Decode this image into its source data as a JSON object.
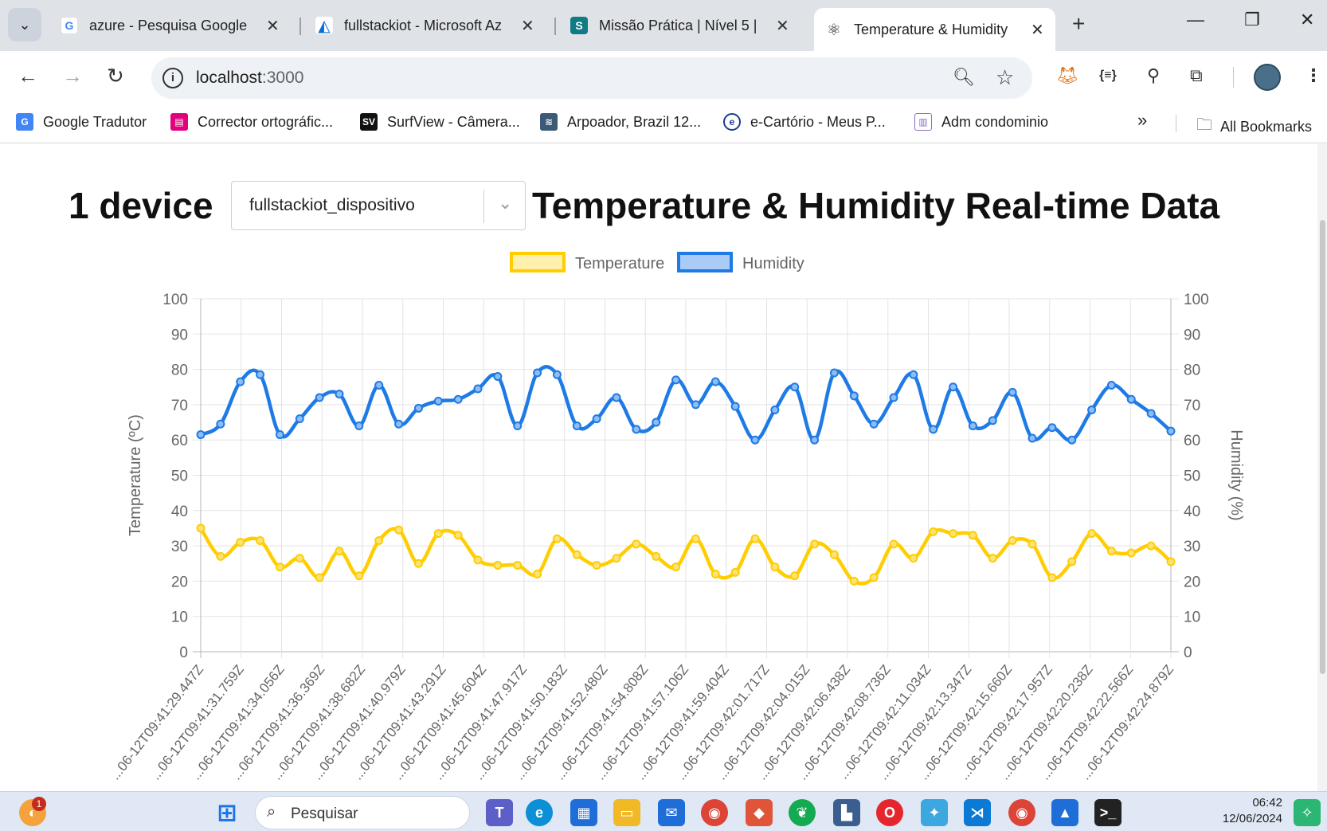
{
  "browser": {
    "tabs": [
      {
        "title": "azure - Pesquisa Google",
        "icon": "google-icon"
      },
      {
        "title": "fullstackiot - Microsoft Az",
        "icon": "azure-icon"
      },
      {
        "title": "Missão Prática | Nível 5 |",
        "icon": "sharepoint-icon"
      },
      {
        "title": "Temperature & Humidity",
        "icon": "react-icon"
      }
    ],
    "url_host": "localhost",
    "url_port": ":3000",
    "bookmarks": [
      {
        "label": "Google Tradutor"
      },
      {
        "label": "Corrector ortográfic..."
      },
      {
        "label": "SurfView - Câmera..."
      },
      {
        "label": "Arpoador, Brazil 12..."
      },
      {
        "label": "e-Cartório - Meus P..."
      },
      {
        "label": "Adm condominio"
      }
    ],
    "more_bookmarks": "»",
    "all_bookmarks": "All Bookmarks"
  },
  "page": {
    "device_count": "1 device",
    "selected_device": "fullstackiot_dispositivo",
    "title": "Temperature & Humidity Real-time Data"
  },
  "chart_data": {
    "type": "line",
    "legend": [
      "Temperature",
      "Humidity"
    ],
    "legend_position": "top",
    "y_left_label": "Temperature (ºC)",
    "y_right_label": "Humidity (%)",
    "ylim": [
      0,
      100
    ],
    "y_ticks": [
      0,
      10,
      20,
      30,
      40,
      50,
      60,
      70,
      80,
      90,
      100
    ],
    "grid": true,
    "x_tick_labels": [
      "...06-12T09:41:29.447Z",
      "...06-12T09:41:31.759Z",
      "...06-12T09:41:34.056Z",
      "...06-12T09:41:36.369Z",
      "...06-12T09:41:38.682Z",
      "...06-12T09:41:40.979Z",
      "...06-12T09:41:43.291Z",
      "...06-12T09:41:45.604Z",
      "...06-12T09:41:47.917Z",
      "...06-12T09:41:50.183Z",
      "...06-12T09:41:52.480Z",
      "...06-12T09:41:54.808Z",
      "...06-12T09:41:57.106Z",
      "...06-12T09:41:59.404Z",
      "...06-12T09:42:01.717Z",
      "...06-12T09:42:04.015Z",
      "...06-12T09:42:06.438Z",
      "...06-12T09:42:08.736Z",
      "...06-12T09:42:11.034Z",
      "...06-12T09:42:13.347Z",
      "...06-12T09:42:15.660Z",
      "...06-12T09:42:17.957Z",
      "...06-12T09:42:20.238Z",
      "...06-12T09:42:22.566Z",
      "...06-12T09:42:24.879Z"
    ],
    "series": [
      {
        "name": "Temperature",
        "color": "#ffcd00",
        "values": [
          35,
          27,
          31,
          31.5,
          24,
          26.5,
          21,
          28.5,
          21.5,
          31.5,
          34.5,
          25,
          33.5,
          33,
          26,
          24.5,
          24.5,
          22,
          32,
          27.5,
          24.5,
          26.5,
          30.5,
          27,
          24,
          32,
          22,
          22.5,
          32,
          24,
          21.5,
          30.5,
          27.5,
          20,
          21,
          30.5,
          26.5,
          34,
          33.5,
          33,
          26.5,
          31.5,
          30.5,
          21,
          25.5,
          33.5,
          28.5,
          28,
          30,
          25.5
        ]
      },
      {
        "name": "Humidity",
        "color": "#1e7be6",
        "values": [
          61.5,
          64.5,
          76.5,
          78.5,
          61.5,
          66,
          72,
          73,
          64,
          75.5,
          64.5,
          69,
          71,
          71.5,
          74.5,
          78,
          64,
          79,
          78.5,
          64,
          66,
          72,
          63,
          65,
          77,
          70,
          76.5,
          69.5,
          60,
          68.5,
          75,
          60,
          79,
          72.5,
          64.5,
          72,
          78.5,
          63,
          75,
          64,
          65.5,
          73.5,
          60.5,
          63.5,
          60,
          68.5,
          75.5,
          71.5,
          67.5,
          62.5
        ]
      }
    ]
  },
  "taskbar": {
    "search_placeholder": "Pesquisar",
    "time": "06:42",
    "date": "12/06/2024",
    "badge_count": "1"
  }
}
